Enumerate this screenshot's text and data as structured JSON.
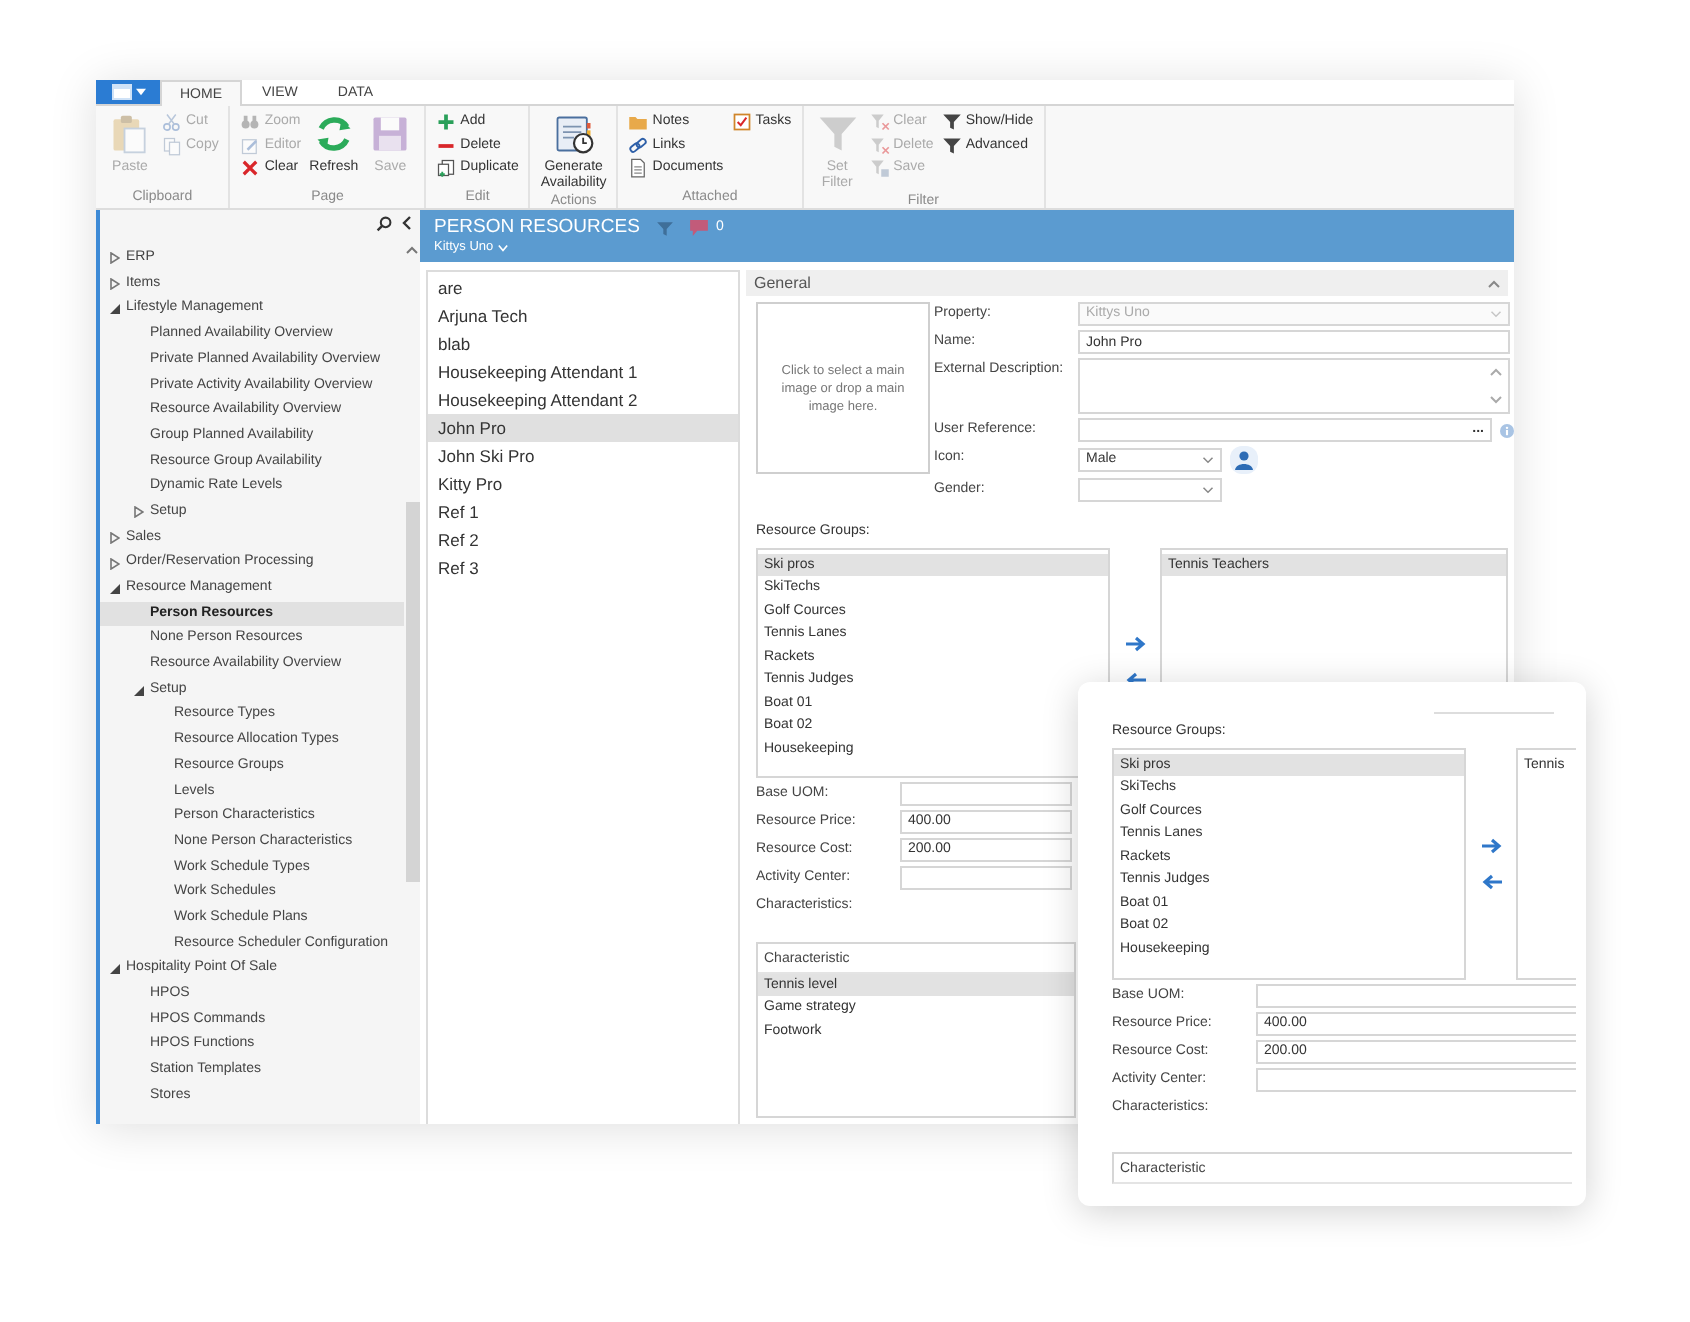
{
  "ribbon": {
    "tabs": [
      {
        "label": "HOME",
        "selected": true
      },
      {
        "label": "VIEW",
        "selected": false
      },
      {
        "label": "DATA",
        "selected": false
      }
    ],
    "groups": [
      {
        "label": "Clipboard",
        "items": [
          {
            "label": "Paste",
            "kind": "large",
            "disabled": true
          },
          {
            "label": "Cut",
            "kind": "small",
            "disabled": true
          },
          {
            "label": "Copy",
            "kind": "small",
            "disabled": true
          }
        ]
      },
      {
        "label": "Page",
        "items": [
          {
            "label": "Zoom",
            "kind": "small",
            "disabled": true
          },
          {
            "label": "Editor",
            "kind": "small",
            "disabled": true
          },
          {
            "label": "Clear",
            "kind": "small",
            "disabled": false
          },
          {
            "label": "Refresh",
            "kind": "large",
            "disabled": false
          },
          {
            "label": "Save",
            "kind": "large",
            "disabled": true
          }
        ]
      },
      {
        "label": "Edit",
        "items": [
          {
            "label": "Add",
            "kind": "small",
            "disabled": false
          },
          {
            "label": "Delete",
            "kind": "small",
            "disabled": false
          },
          {
            "label": "Duplicate",
            "kind": "small",
            "disabled": false
          }
        ]
      },
      {
        "label": "Actions",
        "items": [
          {
            "label": "Generate Availability",
            "kind": "large",
            "disabled": false
          }
        ]
      },
      {
        "label": "Attached",
        "items": [
          {
            "label": "Notes",
            "kind": "small",
            "disabled": false
          },
          {
            "label": "Links",
            "kind": "small",
            "disabled": false
          },
          {
            "label": "Documents",
            "kind": "small",
            "disabled": false
          },
          {
            "label": "Tasks",
            "kind": "small",
            "disabled": false
          }
        ]
      },
      {
        "label": "Filter",
        "items": [
          {
            "label": "Set Filter",
            "kind": "large",
            "disabled": true
          },
          {
            "label": "Clear",
            "kind": "small",
            "disabled": true
          },
          {
            "label": "Delete",
            "kind": "small",
            "disabled": true
          },
          {
            "label": "Save",
            "kind": "small",
            "disabled": true
          },
          {
            "label": "Show/Hide",
            "kind": "small",
            "disabled": false
          },
          {
            "label": "Advanced",
            "kind": "small",
            "disabled": false
          }
        ]
      }
    ]
  },
  "sidebar": {
    "tree": [
      {
        "label": "ERP",
        "expanded": false,
        "selected": false
      },
      {
        "label": "Items",
        "expanded": false,
        "selected": false
      },
      {
        "label": "Lifestyle Management",
        "expanded": true,
        "selected": false,
        "children": [
          {
            "label": "Planned Availability Overview",
            "selected": false
          },
          {
            "label": "Private Planned Availability Overview",
            "selected": false
          },
          {
            "label": "Private Activity Availability Overview",
            "selected": false
          },
          {
            "label": "Resource Availability Overview",
            "selected": false
          },
          {
            "label": "Group Planned Availability",
            "selected": false
          },
          {
            "label": "Resource Group Availability",
            "selected": false
          },
          {
            "label": "Dynamic Rate Levels",
            "selected": false
          },
          {
            "label": "Setup",
            "expanded": false,
            "selected": false
          }
        ]
      },
      {
        "label": "Sales",
        "expanded": false,
        "selected": false
      },
      {
        "label": "Order/Reservation Processing",
        "expanded": false,
        "selected": false
      },
      {
        "label": "Resource Management",
        "expanded": true,
        "selected": false,
        "children": [
          {
            "label": "Person Resources",
            "selected": true
          },
          {
            "label": "None Person Resources",
            "selected": false
          },
          {
            "label": "Resource Availability Overview",
            "selected": false
          },
          {
            "label": "Setup",
            "expanded": true,
            "selected": false,
            "children": [
              {
                "label": "Resource Types",
                "selected": false
              },
              {
                "label": "Resource Allocation Types",
                "selected": false
              },
              {
                "label": "Resource Groups",
                "selected": false
              },
              {
                "label": "Levels",
                "selected": false
              },
              {
                "label": "Person Characteristics",
                "selected": false
              },
              {
                "label": "None Person Characteristics",
                "selected": false
              },
              {
                "label": "Work Schedule Types",
                "selected": false
              },
              {
                "label": "Work Schedules",
                "selected": false
              },
              {
                "label": "Work Schedule Plans",
                "selected": false
              },
              {
                "label": "Resource Scheduler Configuration",
                "selected": false
              }
            ]
          }
        ]
      },
      {
        "label": "Hospitality Point Of Sale",
        "expanded": true,
        "selected": false,
        "children": [
          {
            "label": "HPOS",
            "selected": false
          },
          {
            "label": "HPOS Commands",
            "selected": false
          },
          {
            "label": "HPOS Functions",
            "selected": false
          },
          {
            "label": "Station Templates",
            "selected": false
          },
          {
            "label": "Stores",
            "selected": false
          }
        ]
      }
    ]
  },
  "header": {
    "title": "PERSON RESOURCES",
    "comment_count": "0",
    "property": "Kittys Uno"
  },
  "records": [
    {
      "label": "are",
      "selected": false
    },
    {
      "label": "Arjuna Tech",
      "selected": false
    },
    {
      "label": "blab",
      "selected": false
    },
    {
      "label": "Housekeeping Attendant 1",
      "selected": false
    },
    {
      "label": "Housekeeping Attendant 2",
      "selected": false
    },
    {
      "label": "John Pro",
      "selected": true
    },
    {
      "label": "John Ski Pro",
      "selected": false
    },
    {
      "label": "Kitty Pro",
      "selected": false
    },
    {
      "label": "Ref 1",
      "selected": false
    },
    {
      "label": "Ref 2",
      "selected": false
    },
    {
      "label": "Ref 3",
      "selected": false
    }
  ],
  "general": {
    "title": "General",
    "image_hint": "Click to select a main image or drop a main image here.",
    "fields": [
      {
        "label": "Property:",
        "kind": "select",
        "value": "Kittys Uno",
        "disabled": true
      },
      {
        "label": "Name:",
        "kind": "text",
        "value": "John Pro",
        "disabled": false
      },
      {
        "label": "External Description:",
        "kind": "textarea",
        "disabled": false
      },
      {
        "label": "User Reference:",
        "kind": "lookup",
        "button": "...",
        "disabled": false
      },
      {
        "label": "Icon:",
        "kind": "icon-select",
        "value": "Male",
        "disabled": false
      },
      {
        "label": "Gender:",
        "kind": "short-select",
        "disabled": false
      }
    ],
    "groups_label": "Resource Groups:",
    "available": [
      {
        "label": "Ski pros",
        "selected": true
      },
      {
        "label": "SkiTechs",
        "selected": false
      },
      {
        "label": "Golf Cources",
        "selected": false
      },
      {
        "label": "Tennis Lanes",
        "selected": false
      },
      {
        "label": "Rackets",
        "selected": false
      },
      {
        "label": "Tennis Judges",
        "selected": false
      },
      {
        "label": "Boat 01",
        "selected": false
      },
      {
        "label": "Boat 02",
        "selected": false
      },
      {
        "label": "Housekeeping",
        "selected": false
      }
    ],
    "assigned": [
      {
        "label": "Tennis Teachers",
        "selected": true
      }
    ],
    "pricing": [
      {
        "label": "Base UOM:"
      },
      {
        "label": "Resource Price:",
        "value": "400.00"
      },
      {
        "label": "Resource Cost:",
        "value": "200.00"
      },
      {
        "label": "Activity Center:"
      }
    ],
    "characteristics_label": "Characteristics:",
    "grid": {
      "header": "Characteristic",
      "rows": [
        {
          "label": "Tennis level",
          "selected": true
        },
        {
          "label": "Game strategy",
          "selected": false
        },
        {
          "label": "Footwork",
          "selected": false
        }
      ]
    }
  },
  "zoom_card": {
    "groups_label": "Resource Groups:",
    "available": [
      {
        "label": "Ski pros",
        "selected": true
      },
      {
        "label": "SkiTechs",
        "selected": false
      },
      {
        "label": "Golf Cources",
        "selected": false
      },
      {
        "label": "Tennis Lanes",
        "selected": false
      },
      {
        "label": "Rackets",
        "selected": false
      },
      {
        "label": "Tennis Judges",
        "selected": false
      },
      {
        "label": "Boat 01",
        "selected": false
      },
      {
        "label": "Boat 02",
        "selected": false
      },
      {
        "label": "Housekeeping",
        "selected": false
      }
    ],
    "assigned": [
      {
        "label": "Tennis",
        "selected": false
      }
    ],
    "pricing": [
      {
        "label": "Base UOM:"
      },
      {
        "label": "Resource Price:",
        "value": "400.00"
      },
      {
        "label": "Resource Cost:",
        "value": "200.00"
      },
      {
        "label": "Activity Center:"
      }
    ],
    "characteristics_label": "Characteristics:",
    "grid_header": "Characteristic"
  }
}
